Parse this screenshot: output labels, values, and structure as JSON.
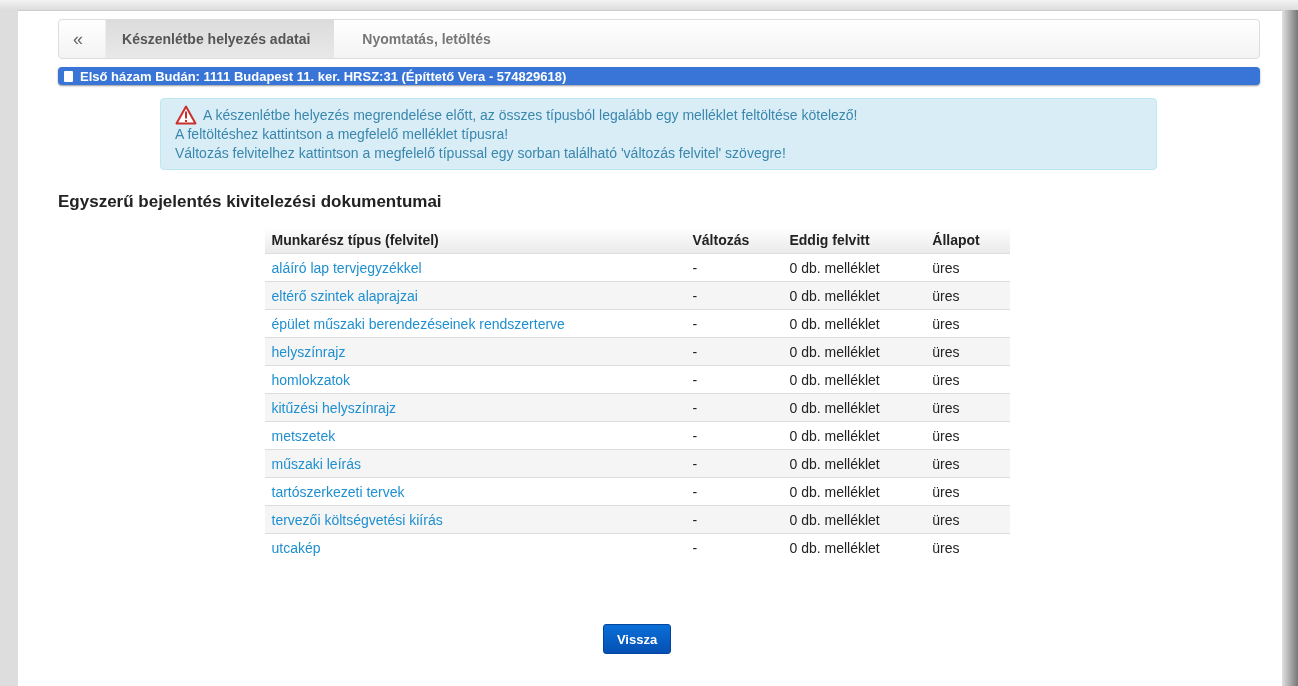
{
  "nav": {
    "back": "«",
    "tabs": [
      {
        "label": "Készenlétbe helyezés adatai",
        "selected": true
      },
      {
        "label": "Nyomtatás, letöltés",
        "selected": false
      }
    ]
  },
  "project_bar": {
    "title": "Első házam Budán: 1111 Budapest 11. ker. HRSZ:31 (Építtető Vera - 574829618)"
  },
  "alert": {
    "lines": [
      "A készenlétbe helyezés megrendelése előtt, az összes típusból legalább egy melléklet feltöltése kötelező!",
      "A feltöltéshez kattintson a megfelelő melléklet típusra!",
      "Változás felvitelhez kattintson a megfelelő típussal egy sorban található 'változás felvitel' szövegre!"
    ]
  },
  "heading": "Egyszerű bejelentés kivitelezési dokumentumai",
  "table": {
    "columns": [
      "Munkarész típus (felvitel)",
      "Változás",
      "Eddig felvitt",
      "Állapot"
    ],
    "rows": [
      {
        "type": "aláíró lap tervjegyzékkel",
        "change": "-",
        "uploaded": "0 db. melléklet",
        "status": "üres"
      },
      {
        "type": "eltérő szintek alaprajzai",
        "change": "-",
        "uploaded": "0 db. melléklet",
        "status": "üres"
      },
      {
        "type": "épület műszaki berendezéseinek rendszerterve",
        "change": "-",
        "uploaded": "0 db. melléklet",
        "status": "üres"
      },
      {
        "type": "helyszínrajz",
        "change": "-",
        "uploaded": "0 db. melléklet",
        "status": "üres"
      },
      {
        "type": "homlokzatok",
        "change": "-",
        "uploaded": "0 db. melléklet",
        "status": "üres"
      },
      {
        "type": "kitűzési helyszínrajz",
        "change": "-",
        "uploaded": "0 db. melléklet",
        "status": "üres"
      },
      {
        "type": "metszetek",
        "change": "-",
        "uploaded": "0 db. melléklet",
        "status": "üres"
      },
      {
        "type": "műszaki leírás",
        "change": "-",
        "uploaded": "0 db. melléklet",
        "status": "üres"
      },
      {
        "type": "tartószerkezeti tervek",
        "change": "-",
        "uploaded": "0 db. melléklet",
        "status": "üres"
      },
      {
        "type": "tervezői költségvetési kiírás",
        "change": "-",
        "uploaded": "0 db. melléklet",
        "status": "üres"
      },
      {
        "type": "utcakép",
        "change": "-",
        "uploaded": "0 db. melléklet",
        "status": "üres"
      }
    ]
  },
  "buttons": [
    "Vissza"
  ]
}
